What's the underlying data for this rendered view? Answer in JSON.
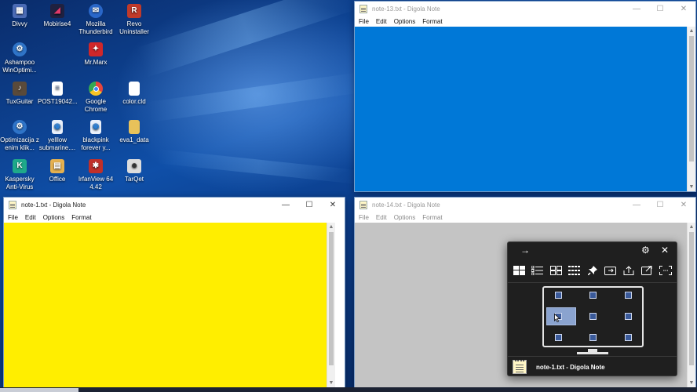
{
  "desktop_icons": [
    {
      "id": "divvy",
      "label": "Divvy",
      "color": "#4b6bb5",
      "glyph": "▦"
    },
    {
      "id": "mobirise",
      "label": "Mobirise4",
      "color": "#1f2140",
      "glyph": "◢"
    },
    {
      "id": "thunderbird",
      "label": "Mozilla Thunderbird",
      "color": "#2a67c9",
      "glyph": "✉"
    },
    {
      "id": "revo",
      "label": "Revo Uninstaller",
      "color": "#c03a2a",
      "glyph": "R"
    },
    {
      "id": "ashampoo",
      "label": "Ashampoo WinOptimi...",
      "color": "#2f74c8",
      "glyph": "⚙"
    },
    {
      "id": "mrmarx",
      "label": "Mr.Marx",
      "color": "#d0272a",
      "glyph": "✦"
    },
    {
      "id": "tuxguitar",
      "label": "TuxGuitar",
      "color": "#5a4a3a",
      "glyph": "♪"
    },
    {
      "id": "post",
      "label": "POST19042...",
      "color": "#ffffff",
      "glyph": "≡"
    },
    {
      "id": "chrome",
      "label": "Google Chrome",
      "color": "#e8453c",
      "glyph": "●"
    },
    {
      "id": "colorcld",
      "label": "color.cld",
      "color": "#ffffff",
      "glyph": ""
    },
    {
      "id": "optimizacija",
      "label": "Optimizacija z enim klik...",
      "color": "#2f74c8",
      "glyph": "⚙"
    },
    {
      "id": "yelllow",
      "label": "yelllow submarine....",
      "color": "#e9f0fb",
      "glyph": "◉"
    },
    {
      "id": "blackpink",
      "label": "blackpink forever y...",
      "color": "#e9f0fb",
      "glyph": "◉"
    },
    {
      "id": "eva1",
      "label": "eva1_data",
      "color": "#e8c25a",
      "glyph": ""
    },
    {
      "id": "kaspersky",
      "label": "Kaspersky Anti-Virus",
      "color": "#1ea98a",
      "glyph": "K"
    },
    {
      "id": "office",
      "label": "Office",
      "color": "#e5b150",
      "glyph": "▤"
    },
    {
      "id": "irfanview",
      "label": "IrfanView 64 4.42",
      "color": "#c0302a",
      "glyph": "✱"
    },
    {
      "id": "tarqet",
      "label": "TarQet",
      "color": "#ddd",
      "glyph": "☻"
    }
  ],
  "windows": {
    "note13": {
      "title": "note-13.txt - Digola Note",
      "bg": "#0078d7"
    },
    "note1": {
      "title": "note-1.txt - Digola Note",
      "bg": "#ffee00"
    },
    "note14": {
      "title": "note-14.txt - Digola Note",
      "bg": "#c4c4c4"
    }
  },
  "menu": {
    "file": "File",
    "edit": "Edit",
    "options": "Options",
    "format": "Format"
  },
  "controls": {
    "minimize": "—",
    "maximize": "☐",
    "close": "✕"
  },
  "panel": {
    "back_icon": "→",
    "settings_icon": "⚙",
    "close_icon": "✕",
    "active_window": "note-1.txt - Digola Note",
    "tools": [
      "grid-layout-icon",
      "checklist-icon",
      "split-layout-icon",
      "dots-grid-icon",
      "pin-icon",
      "move-to-monitor-icon",
      "upload-icon",
      "open-external-icon",
      "fullscreen-icon"
    ]
  }
}
